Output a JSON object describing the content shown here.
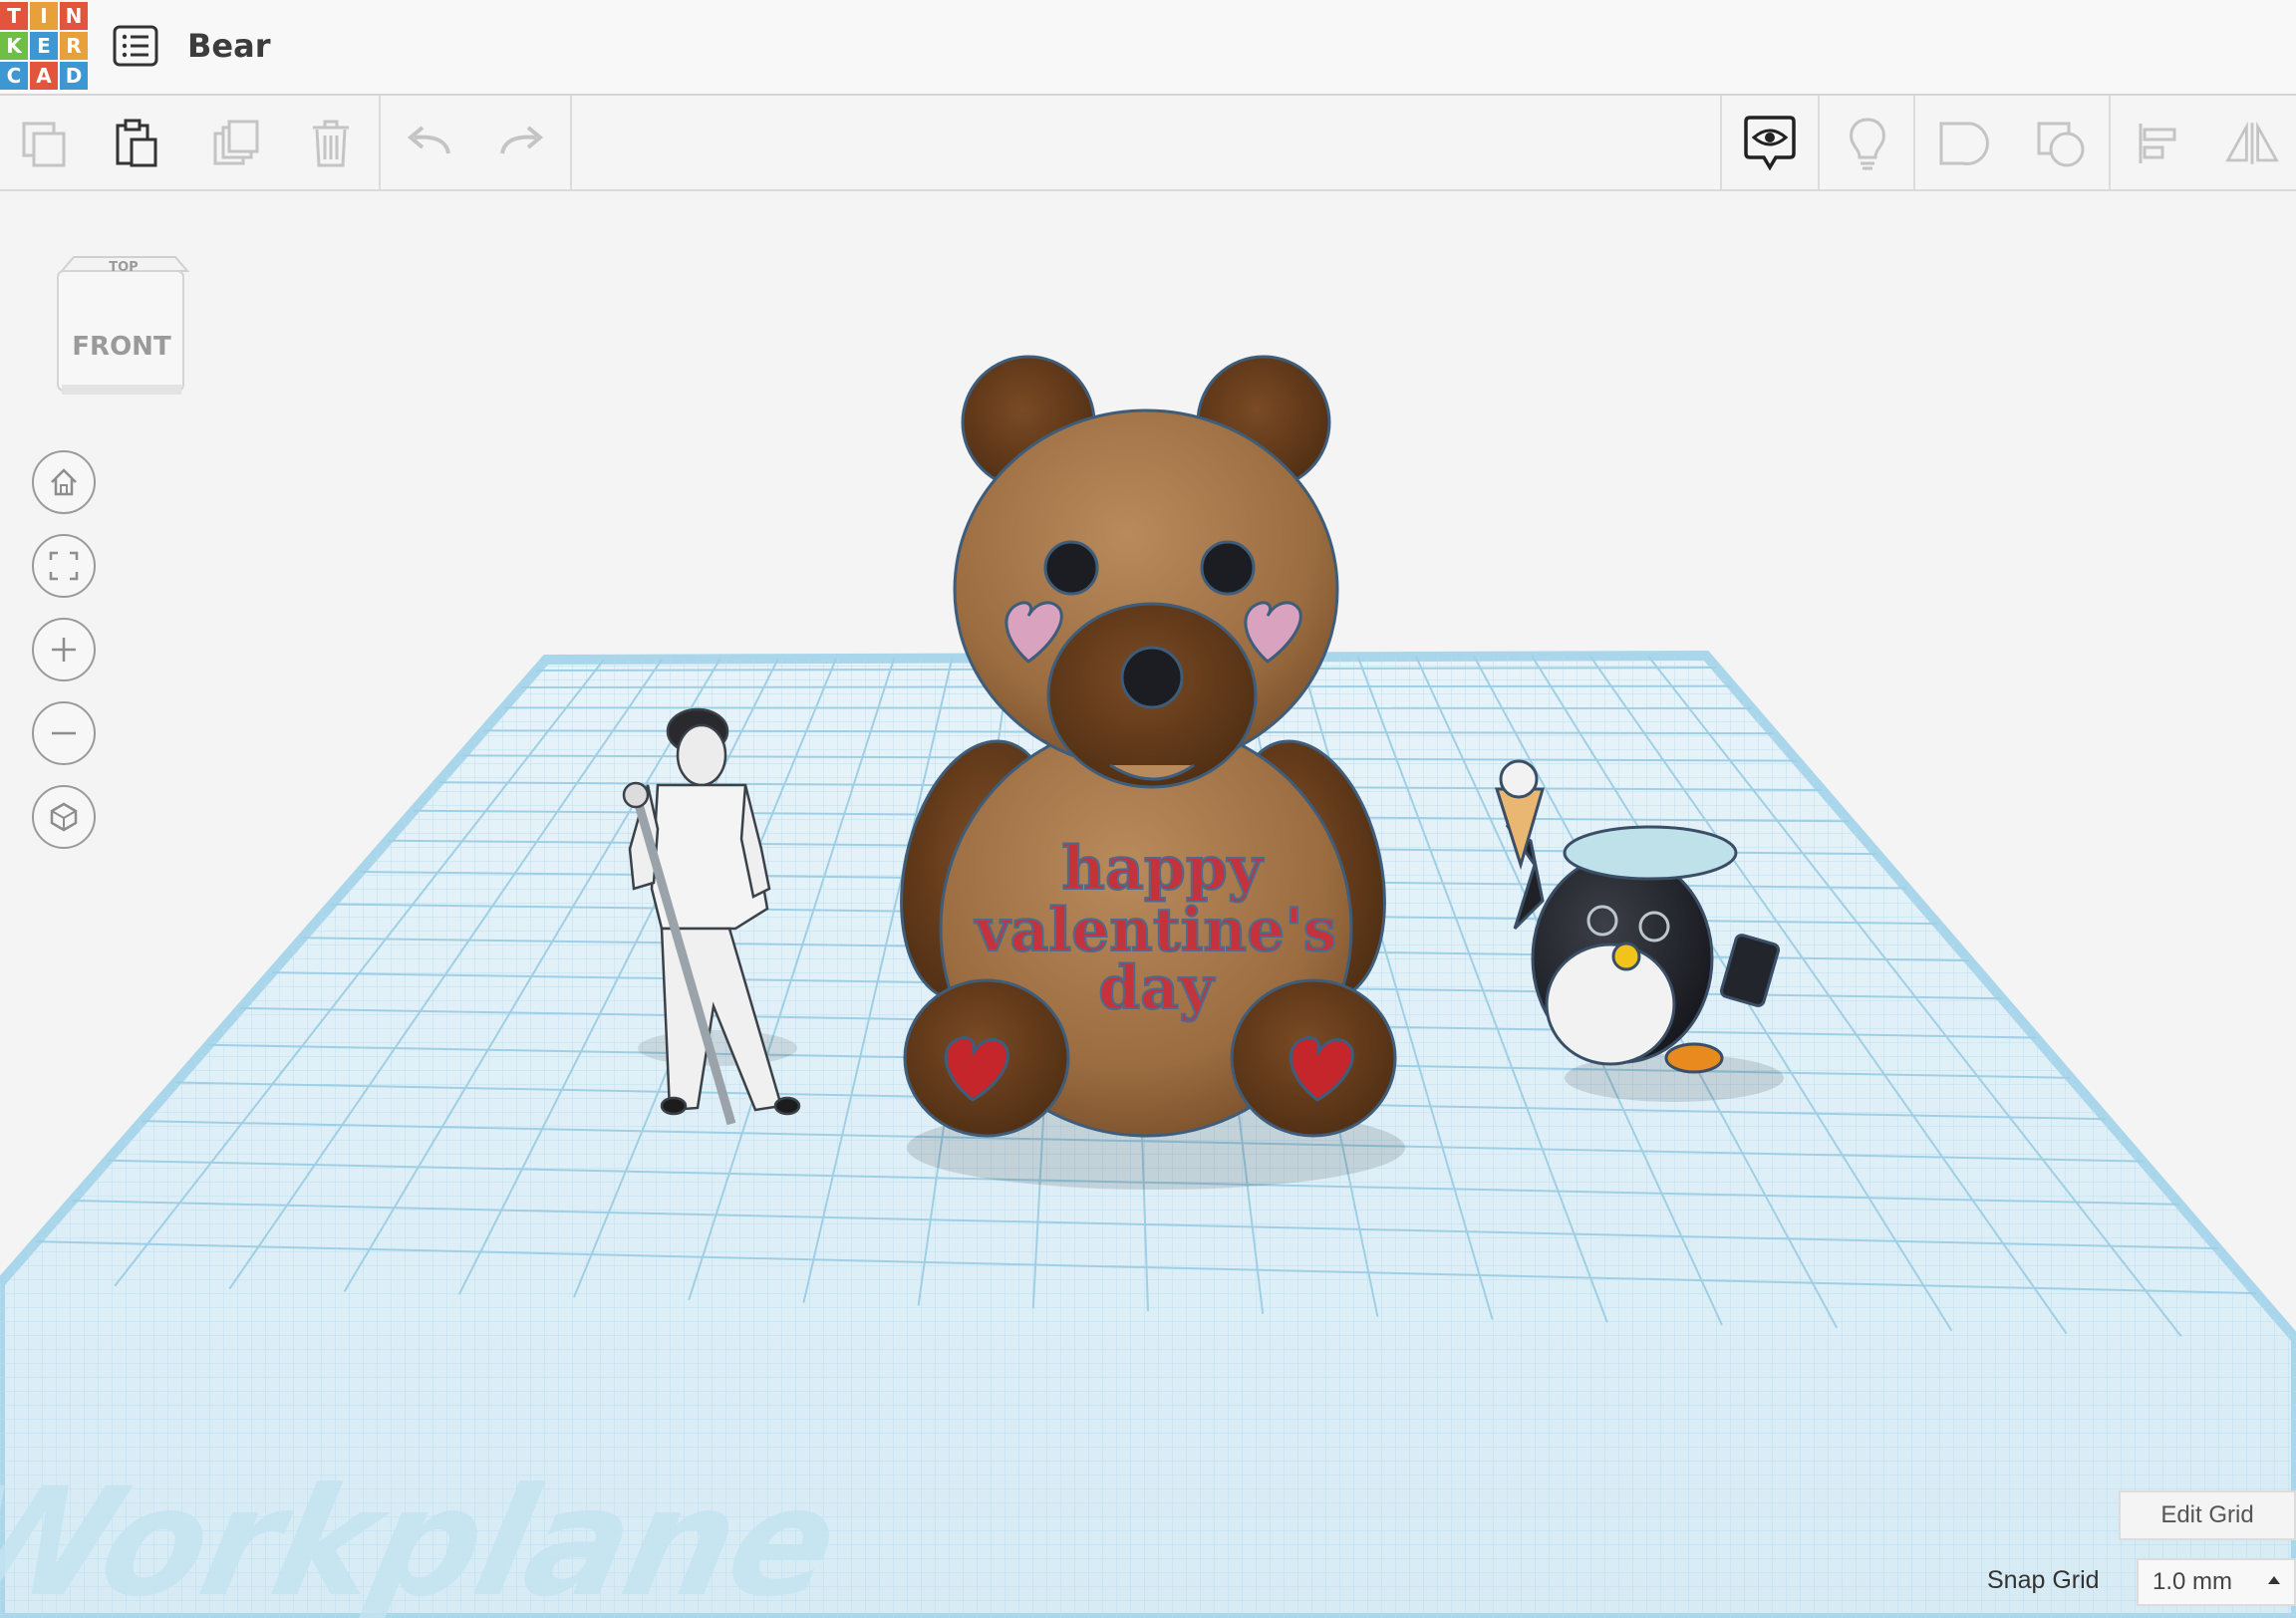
{
  "app": {
    "logo_letters": [
      "T",
      "I",
      "N",
      "K",
      "E",
      "R",
      "C",
      "A",
      "D"
    ],
    "logo_colors": [
      "#e2543c",
      "#e8a03a",
      "#e2543c",
      "#6fbf45",
      "#3d97d3",
      "#e8a03a",
      "#3d97d3",
      "#e2543c",
      "#3d97d3"
    ],
    "design_title": "Bear"
  },
  "toolbar": {
    "left_icons": [
      "copy-icon",
      "paste-icon",
      "duplicate-icon",
      "delete-icon",
      "undo-icon",
      "redo-icon"
    ],
    "right_icons": [
      "view-toggle-icon",
      "lightbulb-icon",
      "group-icon",
      "ungroup-icon",
      "align-icon",
      "mirror-icon"
    ]
  },
  "view_cube": {
    "top_label": "TOP",
    "front_label": "FRONT"
  },
  "nav": [
    "home-view-icon",
    "fit-all-icon",
    "zoom-in-icon",
    "zoom-out-icon",
    "perspective-icon"
  ],
  "workplane": {
    "watermark": "Workplane",
    "grid_color": "#a9d6ea",
    "bear_text": [
      "happy",
      "valentine's",
      "day"
    ]
  },
  "controls": {
    "edit_grid": "Edit Grid",
    "snap_grid_label": "Snap Grid",
    "snap_grid_value": "1.0 mm"
  }
}
